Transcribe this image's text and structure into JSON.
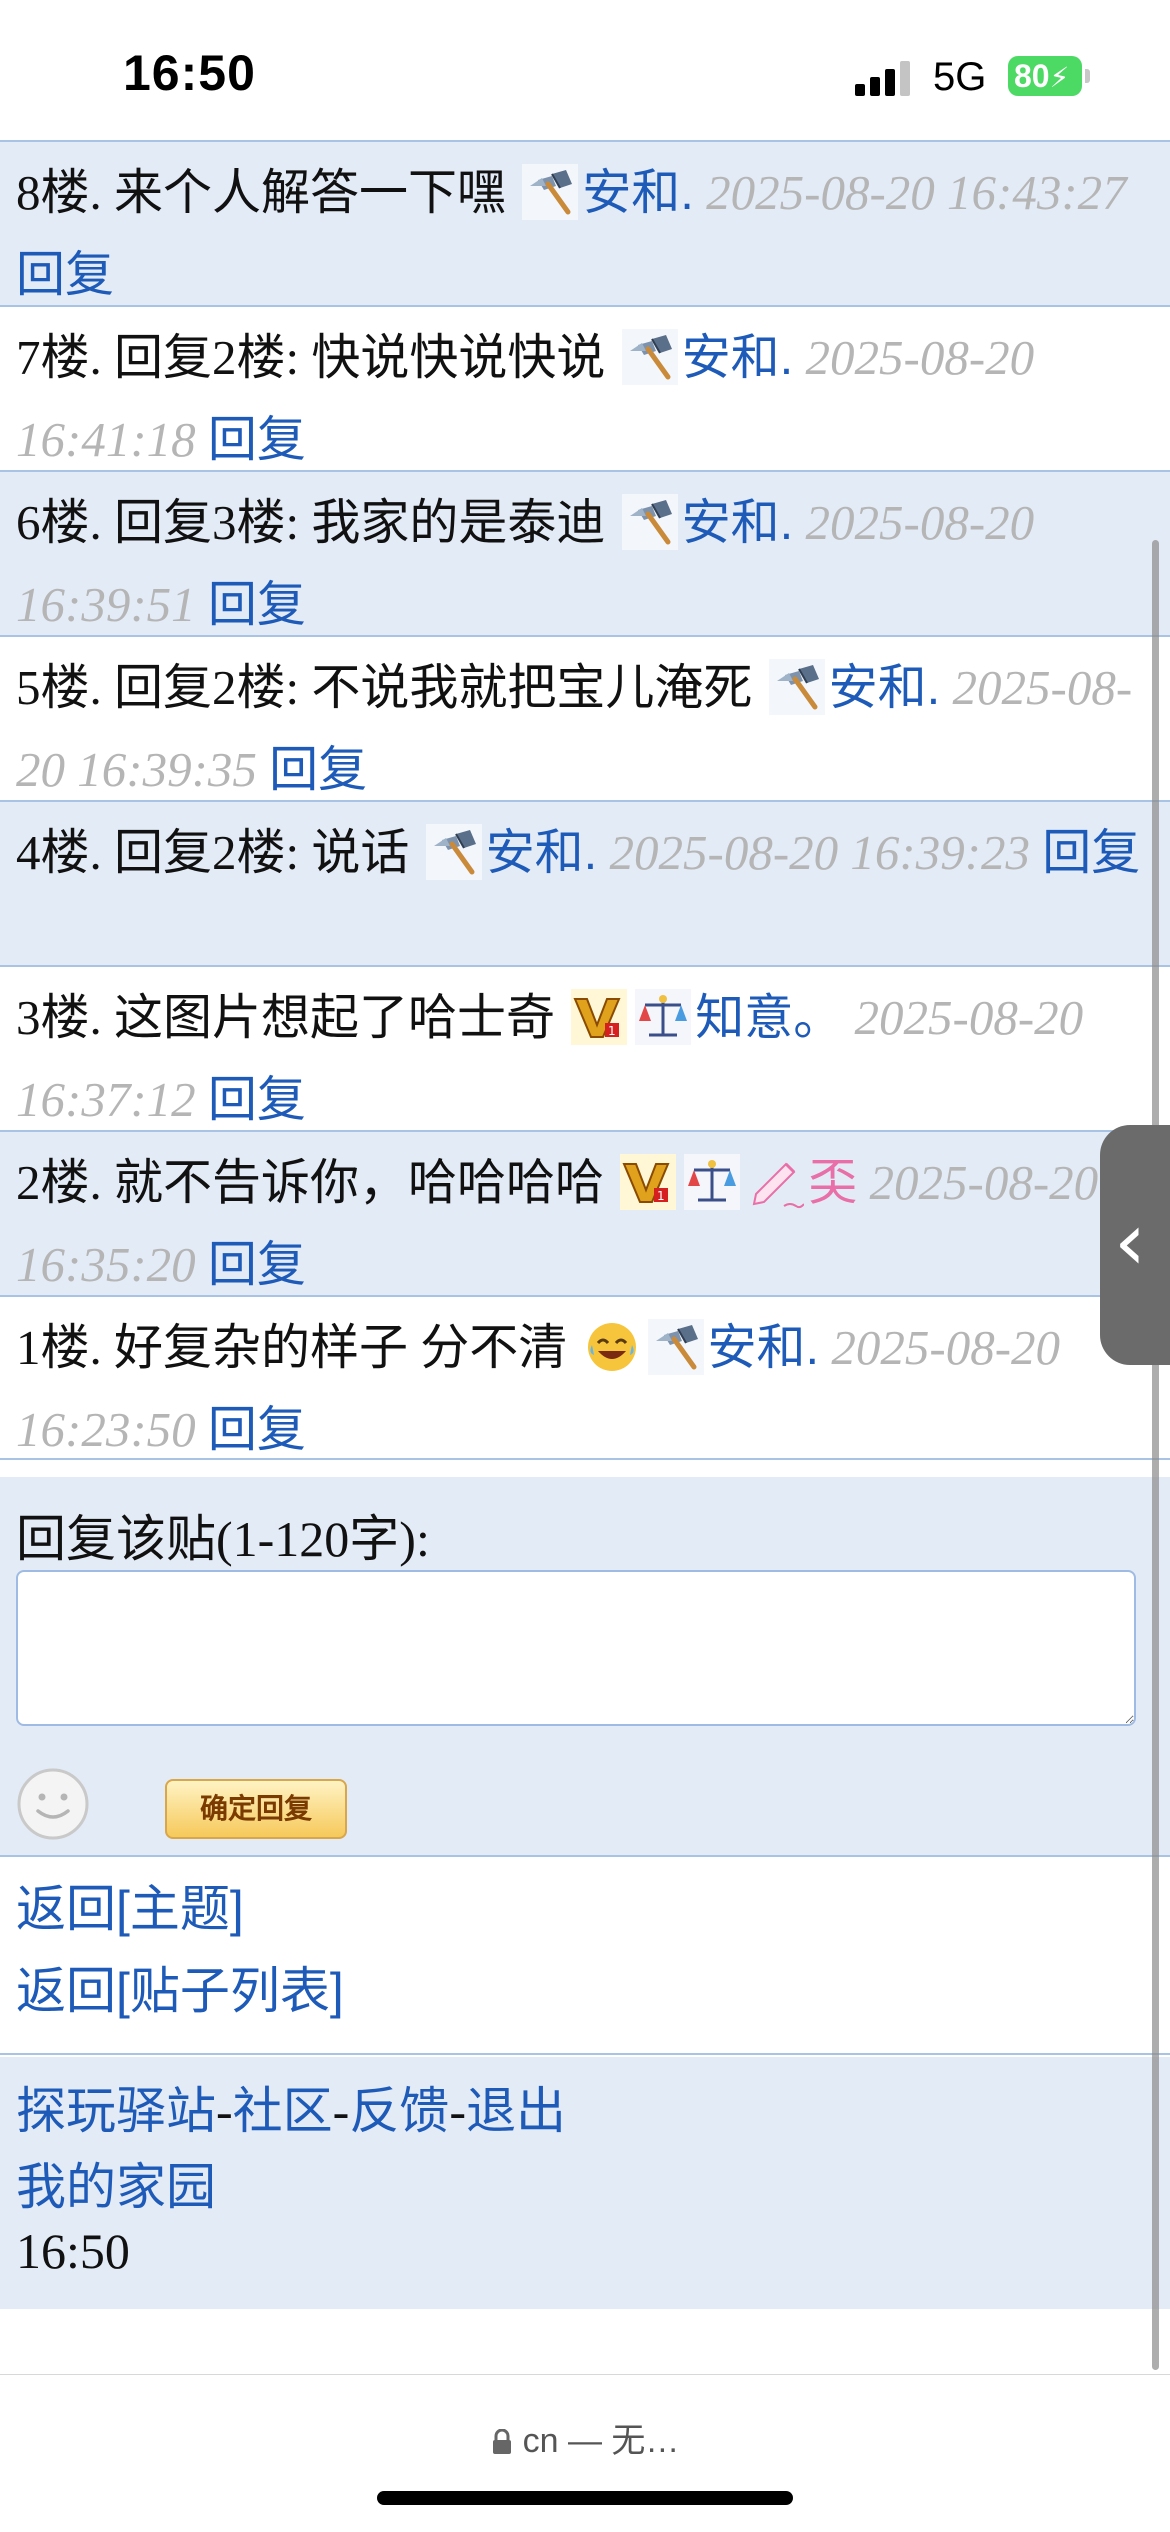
{
  "status": {
    "time": "16:50",
    "network": "5G",
    "battery": "80"
  },
  "posts": [
    {
      "floor": "8楼.",
      "text": " 来个人解答一下嘿",
      "icons": [
        "axe-badge-icon"
      ],
      "user": "安和.",
      "user_color": "#1e5bb8",
      "date": "2025-08-20 16:43:27",
      "reply": "回复"
    },
    {
      "floor": "7楼.",
      "text": " 回复2楼: 快说快说快说",
      "icons": [
        "axe-badge-icon"
      ],
      "user": "安和.",
      "user_color": "#1e5bb8",
      "date": "2025-08-20 16:41:18",
      "reply": "回复"
    },
    {
      "floor": "6楼.",
      "text": " 回复3楼: 我家的是泰迪",
      "icons": [
        "axe-badge-icon"
      ],
      "user": "安和.",
      "user_color": "#1e5bb8",
      "date": "2025-08-20 16:39:51",
      "reply": "回复"
    },
    {
      "floor": "5楼.",
      "text": " 回复2楼: 不说我就把宝儿淹死",
      "icons": [
        "axe-badge-icon"
      ],
      "user": "安和.",
      "user_color": "#1e5bb8",
      "date": "2025-08-20 16:39:35",
      "reply": "回复"
    },
    {
      "floor": "4楼.",
      "text": " 回复2楼: 说话",
      "icons": [
        "axe-badge-icon"
      ],
      "user": "安和.",
      "user_color": "#1e5bb8",
      "date": "2025-08-20 16:39:23",
      "reply": "回复"
    },
    {
      "floor": "3楼.",
      "text": " 这图片想起了哈士奇",
      "icons": [
        "vip-badge-icon",
        "scales-badge-icon"
      ],
      "user": "知意。",
      "user_color": "#1e5bb8",
      "date": "2025-08-20 16:37:12",
      "reply": "回复"
    },
    {
      "floor": "2楼.",
      "text": " 就不告诉你，哈哈哈哈",
      "icons": [
        "vip-badge-icon",
        "scales-badge-icon",
        "pencil-badge-icon"
      ],
      "user": "奀",
      "user_color": "#e86fa8",
      "date": "2025-08-20 16:35:20",
      "reply": "回复"
    },
    {
      "floor": "1楼.",
      "text": " 好复杂的样子 分不清",
      "icons": [
        "laughing-emoji-icon",
        "axe-badge-icon"
      ],
      "user": "安和.",
      "user_color": "#1e5bb8",
      "date": "2025-08-20 16:23:50",
      "reply": "回复"
    }
  ],
  "reply_form": {
    "label": "回复该贴(1-120字):",
    "input_value": "",
    "submit_label": "确定回复"
  },
  "nav": {
    "back_topic": "返回[主题]",
    "back_list": "返回[贴子列表]"
  },
  "footer": {
    "links": [
      "探玩驿站",
      "社区",
      "反馈",
      "退出"
    ],
    "separator": "-",
    "home": "我的家园",
    "time": "16:50"
  },
  "browser": {
    "url": "cn — 无…"
  },
  "colors": {
    "link": "#1e5bb8",
    "date": "#b5b5b5",
    "row_shade": "#e3ebf6",
    "border": "#a9c3e4",
    "pink_user": "#e86fa8"
  }
}
